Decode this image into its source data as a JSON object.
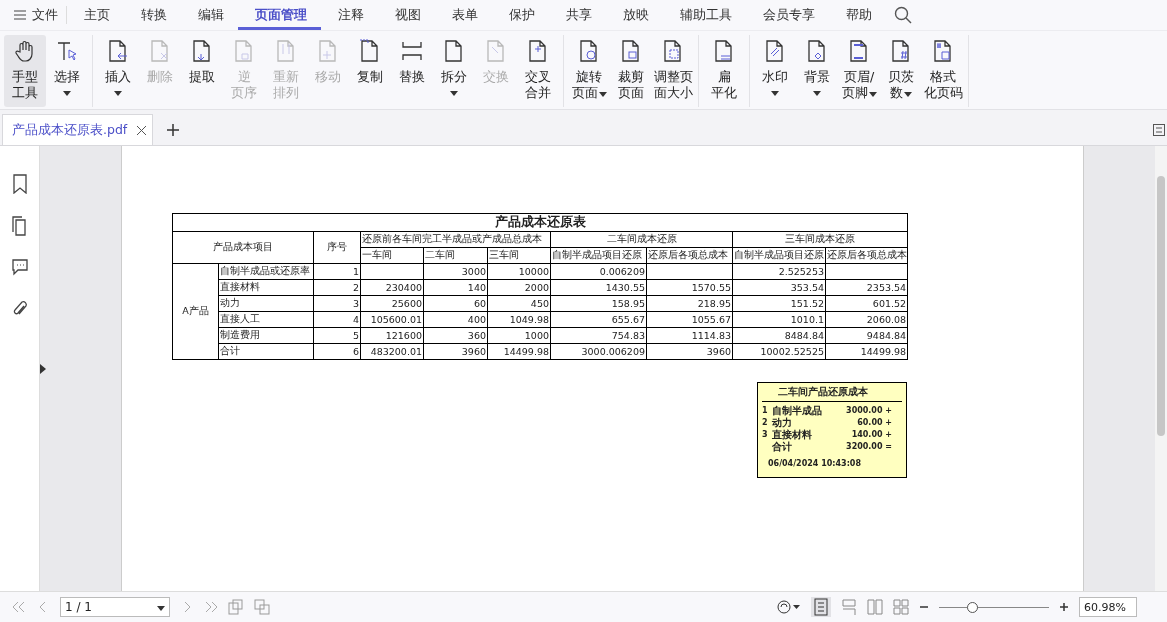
{
  "menu": {
    "file_label": "文件",
    "tabs": [
      {
        "label": "主页",
        "selected": false
      },
      {
        "label": "转换",
        "selected": false
      },
      {
        "label": "编辑",
        "selected": false
      },
      {
        "label": "页面管理",
        "selected": true
      },
      {
        "label": "注释",
        "selected": false
      },
      {
        "label": "视图",
        "selected": false
      },
      {
        "label": "表单",
        "selected": false
      },
      {
        "label": "保护",
        "selected": false
      },
      {
        "label": "共享",
        "selected": false
      },
      {
        "label": "放映",
        "selected": false
      },
      {
        "label": "辅助工具",
        "selected": false
      },
      {
        "label": "会员专享",
        "selected": false
      },
      {
        "label": "帮助",
        "selected": false
      }
    ]
  },
  "toolbar": [
    [
      {
        "lines": [
          "手型",
          "工具"
        ],
        "selected": true,
        "disabled": false,
        "dropdown": false
      },
      {
        "lines": [
          "选择"
        ],
        "selected": false,
        "disabled": false,
        "dropdown": true
      }
    ],
    [
      {
        "lines": [
          "插入"
        ],
        "selected": false,
        "disabled": false,
        "dropdown": true
      },
      {
        "lines": [
          "删除"
        ],
        "selected": false,
        "disabled": true,
        "dropdown": false
      },
      {
        "lines": [
          "提取"
        ],
        "selected": false,
        "disabled": false,
        "dropdown": false
      },
      {
        "lines": [
          "逆",
          "页序"
        ],
        "selected": false,
        "disabled": true,
        "dropdown": false
      },
      {
        "lines": [
          "重新",
          "排列"
        ],
        "selected": false,
        "disabled": true,
        "dropdown": false
      },
      {
        "lines": [
          "移动"
        ],
        "selected": false,
        "disabled": true,
        "dropdown": false
      },
      {
        "lines": [
          "复制"
        ],
        "selected": false,
        "disabled": false,
        "dropdown": false
      },
      {
        "lines": [
          "替换"
        ],
        "selected": false,
        "disabled": false,
        "dropdown": false
      },
      {
        "lines": [
          "拆分"
        ],
        "selected": false,
        "disabled": false,
        "dropdown": true
      },
      {
        "lines": [
          "交换"
        ],
        "selected": false,
        "disabled": true,
        "dropdown": false
      },
      {
        "lines": [
          "交叉",
          "合并"
        ],
        "selected": false,
        "disabled": false,
        "dropdown": false
      }
    ],
    [
      {
        "lines": [
          "旋转",
          "页面"
        ],
        "selected": false,
        "disabled": false,
        "dropdown": true
      },
      {
        "lines": [
          "裁剪",
          "页面"
        ],
        "selected": false,
        "disabled": false,
        "dropdown": false
      },
      {
        "lines": [
          "调整页",
          "面大小"
        ],
        "selected": false,
        "disabled": false,
        "dropdown": false
      }
    ],
    [
      {
        "lines": [
          "扁",
          "平化"
        ],
        "selected": false,
        "disabled": false,
        "dropdown": false
      }
    ],
    [
      {
        "lines": [
          "水印"
        ],
        "selected": false,
        "disabled": false,
        "dropdown": true
      },
      {
        "lines": [
          "背景"
        ],
        "selected": false,
        "disabled": false,
        "dropdown": true
      },
      {
        "lines": [
          "页眉/",
          "页脚"
        ],
        "selected": false,
        "disabled": false,
        "dropdown": true
      },
      {
        "lines": [
          "贝茨",
          "数"
        ],
        "selected": false,
        "disabled": false,
        "dropdown": true
      },
      {
        "lines": [
          "格式",
          "化页码"
        ],
        "selected": false,
        "disabled": false,
        "dropdown": false
      }
    ]
  ],
  "doc_tab": {
    "label": "产品成本还原表.pdf",
    "selected": true
  },
  "table": {
    "title": "产品成本还原表",
    "item_header": "产品成本项目",
    "seq_header": "序号",
    "groups": [
      "还原前各车间完工半成品或产成品总成本",
      "二车间成本还原",
      "三车间成本还原"
    ],
    "subheaders": [
      "一车间",
      "二车间",
      "三车间",
      "自制半成品项目还原",
      "还原后各项总成本",
      "自制半成品项目还原",
      "还原后各项总成本"
    ],
    "product": "A产品",
    "rows": [
      {
        "item": "自制半成品或还原率",
        "seq": "1",
        "values": {
          "ws2": "3000",
          "ws3": "10000",
          "r2_semi": "0.006209",
          "r3_semi": "2.525253"
        }
      },
      {
        "item": "直接材料",
        "seq": "2",
        "values": {
          "ws1": "230400",
          "ws2": "140",
          "ws3": "2000",
          "r2_semi": "1430.55",
          "r2_total": "1570.55",
          "r3_semi": "353.54",
          "r3_total": "2353.54"
        }
      },
      {
        "item": "动力",
        "seq": "3",
        "values": {
          "ws1": "25600",
          "ws2": "60",
          "ws3": "450",
          "r2_semi": "158.95",
          "r2_total": "218.95",
          "r3_semi": "151.52",
          "r3_total": "601.52"
        }
      },
      {
        "item": "直接人工",
        "seq": "4",
        "values": {
          "ws1": "105600.01",
          "ws2": "400",
          "ws3": "1049.98",
          "r2_semi": "655.67",
          "r2_total": "1055.67",
          "r3_semi": "1010.1",
          "r3_total": "2060.08"
        }
      },
      {
        "item": "制造费用",
        "seq": "5",
        "values": {
          "ws1": "121600",
          "ws2": "360",
          "ws3": "1000",
          "r2_semi": "754.83",
          "r2_total": "1114.83",
          "r3_semi": "8484.84",
          "r3_total": "9484.84"
        }
      },
      {
        "item": "合计",
        "seq": "6",
        "values": {
          "ws1": "483200.01",
          "ws2": "3960",
          "ws3": "14499.98",
          "r2_semi": "3000.006209",
          "r2_total": "3960",
          "r3_semi": "10002.52525",
          "r3_total": "14499.98"
        }
      }
    ]
  },
  "note": {
    "title": "二车间产品还原成本",
    "lines": [
      {
        "no": "1",
        "name": "自制半成品",
        "amount": "3000.00 +"
      },
      {
        "no": "2",
        "name": "动力",
        "amount": "60.00 +"
      },
      {
        "no": "3",
        "name": "直接材料",
        "amount": "140.00 +"
      },
      {
        "name": "合计",
        "amount": "3200.00 ="
      }
    ],
    "date": "06/04/2024 10:43:08"
  },
  "status": {
    "page": "1 / 1",
    "zoom": "60.98%",
    "zoom_slider": {
      "level": 0.3
    }
  }
}
